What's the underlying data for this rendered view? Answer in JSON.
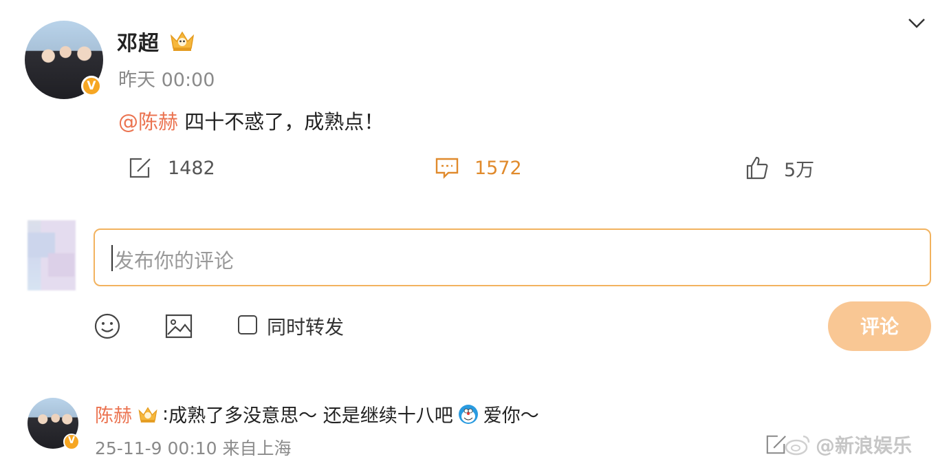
{
  "post": {
    "author": "邓超",
    "time": "昨天 00:00",
    "mention": "@陈赫",
    "text": "四十不惑了，成熟点！",
    "actions": {
      "repost_count": "1482",
      "comment_count": "1572",
      "like_count": "5万"
    },
    "verified_badge": "V"
  },
  "composer": {
    "placeholder": "发布你的评论",
    "repost_label": "同时转发",
    "submit_label": "评论"
  },
  "reply": {
    "author": "陈赫",
    "separator": ":",
    "text_part1": "成熟了多没意思～ 还是继续十八吧",
    "text_part2": "爱你～",
    "meta": "25-11-9 00:10 来自上海",
    "verified_badge": "V"
  },
  "watermark": "@新浪娱乐",
  "colors": {
    "accent_orange": "#eb7350",
    "comment_active": "#e08a2c",
    "input_border": "#f2b25e",
    "submit_bg": "#f9c794",
    "verified": "#f6a623"
  },
  "icons": [
    "chevron-down-icon",
    "crown-icon",
    "repost-icon",
    "comment-icon",
    "like-icon",
    "emoji-icon",
    "image-icon",
    "doraemon-emoji-icon",
    "weibo-logo-icon"
  ]
}
